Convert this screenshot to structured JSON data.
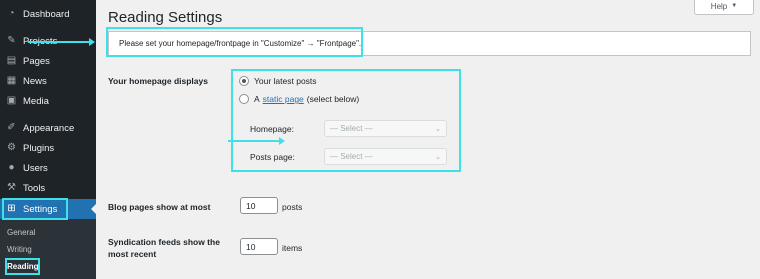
{
  "sidebar": {
    "items": [
      {
        "label": "Dashboard",
        "icon": "dashboard-icon"
      },
      {
        "label": "Projects",
        "icon": "pin-icon"
      },
      {
        "label": "Pages",
        "icon": "pages-icon"
      },
      {
        "label": "News",
        "icon": "news-icon"
      },
      {
        "label": "Media",
        "icon": "media-icon"
      },
      {
        "label": "Appearance",
        "icon": "brush-icon"
      },
      {
        "label": "Plugins",
        "icon": "plugin-icon"
      },
      {
        "label": "Users",
        "icon": "user-icon"
      },
      {
        "label": "Tools",
        "icon": "wrench-icon"
      },
      {
        "label": "Settings",
        "icon": "settings-icon"
      }
    ],
    "submenu": [
      "General",
      "Writing",
      "Reading"
    ]
  },
  "header": {
    "title": "Reading Settings",
    "help_label": "Help"
  },
  "notice": {
    "text": "Please set your homepage/frontpage in \"Customize\" → \"Frontpage\"."
  },
  "homepage": {
    "label": "Your homepage displays",
    "option_latest": "Your latest posts",
    "option_static_prefix": "A",
    "option_static_link": "static page",
    "option_static_suffix": "(select below)",
    "homepage_label": "Homepage:",
    "homepage_select": "— Select —",
    "posts_label": "Posts page:",
    "posts_select": "— Select —"
  },
  "blog_pages": {
    "label": "Blog pages show at most",
    "value": "10",
    "suffix": "posts"
  },
  "feeds": {
    "label_line1": "Syndication feeds show the",
    "label_line2": "most recent",
    "value": "10",
    "suffix": "items"
  },
  "colors": {
    "highlight": "#40e0e8",
    "accent": "#2271b1",
    "sidebar": "#1d2327"
  }
}
